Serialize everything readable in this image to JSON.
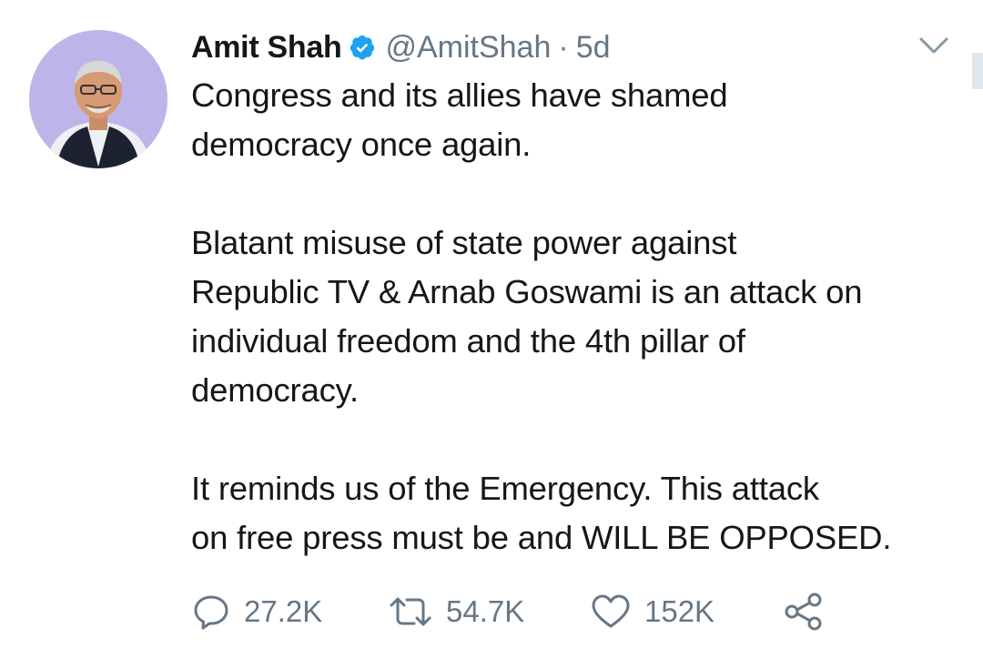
{
  "tweet": {
    "author": {
      "name": "Amit Shah",
      "handle": "@AmitShah",
      "verified": true,
      "avatar_icon": "avatar-photo"
    },
    "separator": "·",
    "time": "5d",
    "paragraphs": [
      {
        "lines": [
          "Congress and its allies have shamed",
          "democracy once again."
        ]
      },
      {
        "lines": [
          "Blatant misuse of state power against",
          "Republic TV & Arnab Goswami is an attack on",
          "individual freedom and the 4th pillar of",
          "democracy."
        ]
      },
      {
        "lines": [
          "It reminds us of the Emergency. This attack",
          "on free press must be and WILL BE OPPOSED."
        ]
      }
    ],
    "actions": {
      "reply": {
        "icon": "reply-icon",
        "count": "27.2K"
      },
      "retweet": {
        "icon": "retweet-icon",
        "count": "54.7K"
      },
      "like": {
        "icon": "like-icon",
        "count": "152K"
      },
      "share": {
        "icon": "share-icon"
      }
    },
    "menu_icon": "chevron-down-icon"
  },
  "colors": {
    "text": "#14171a",
    "muted": "#657786",
    "verified_blue": "#1da1f2",
    "avatar_bg": "#b9b2e6"
  }
}
